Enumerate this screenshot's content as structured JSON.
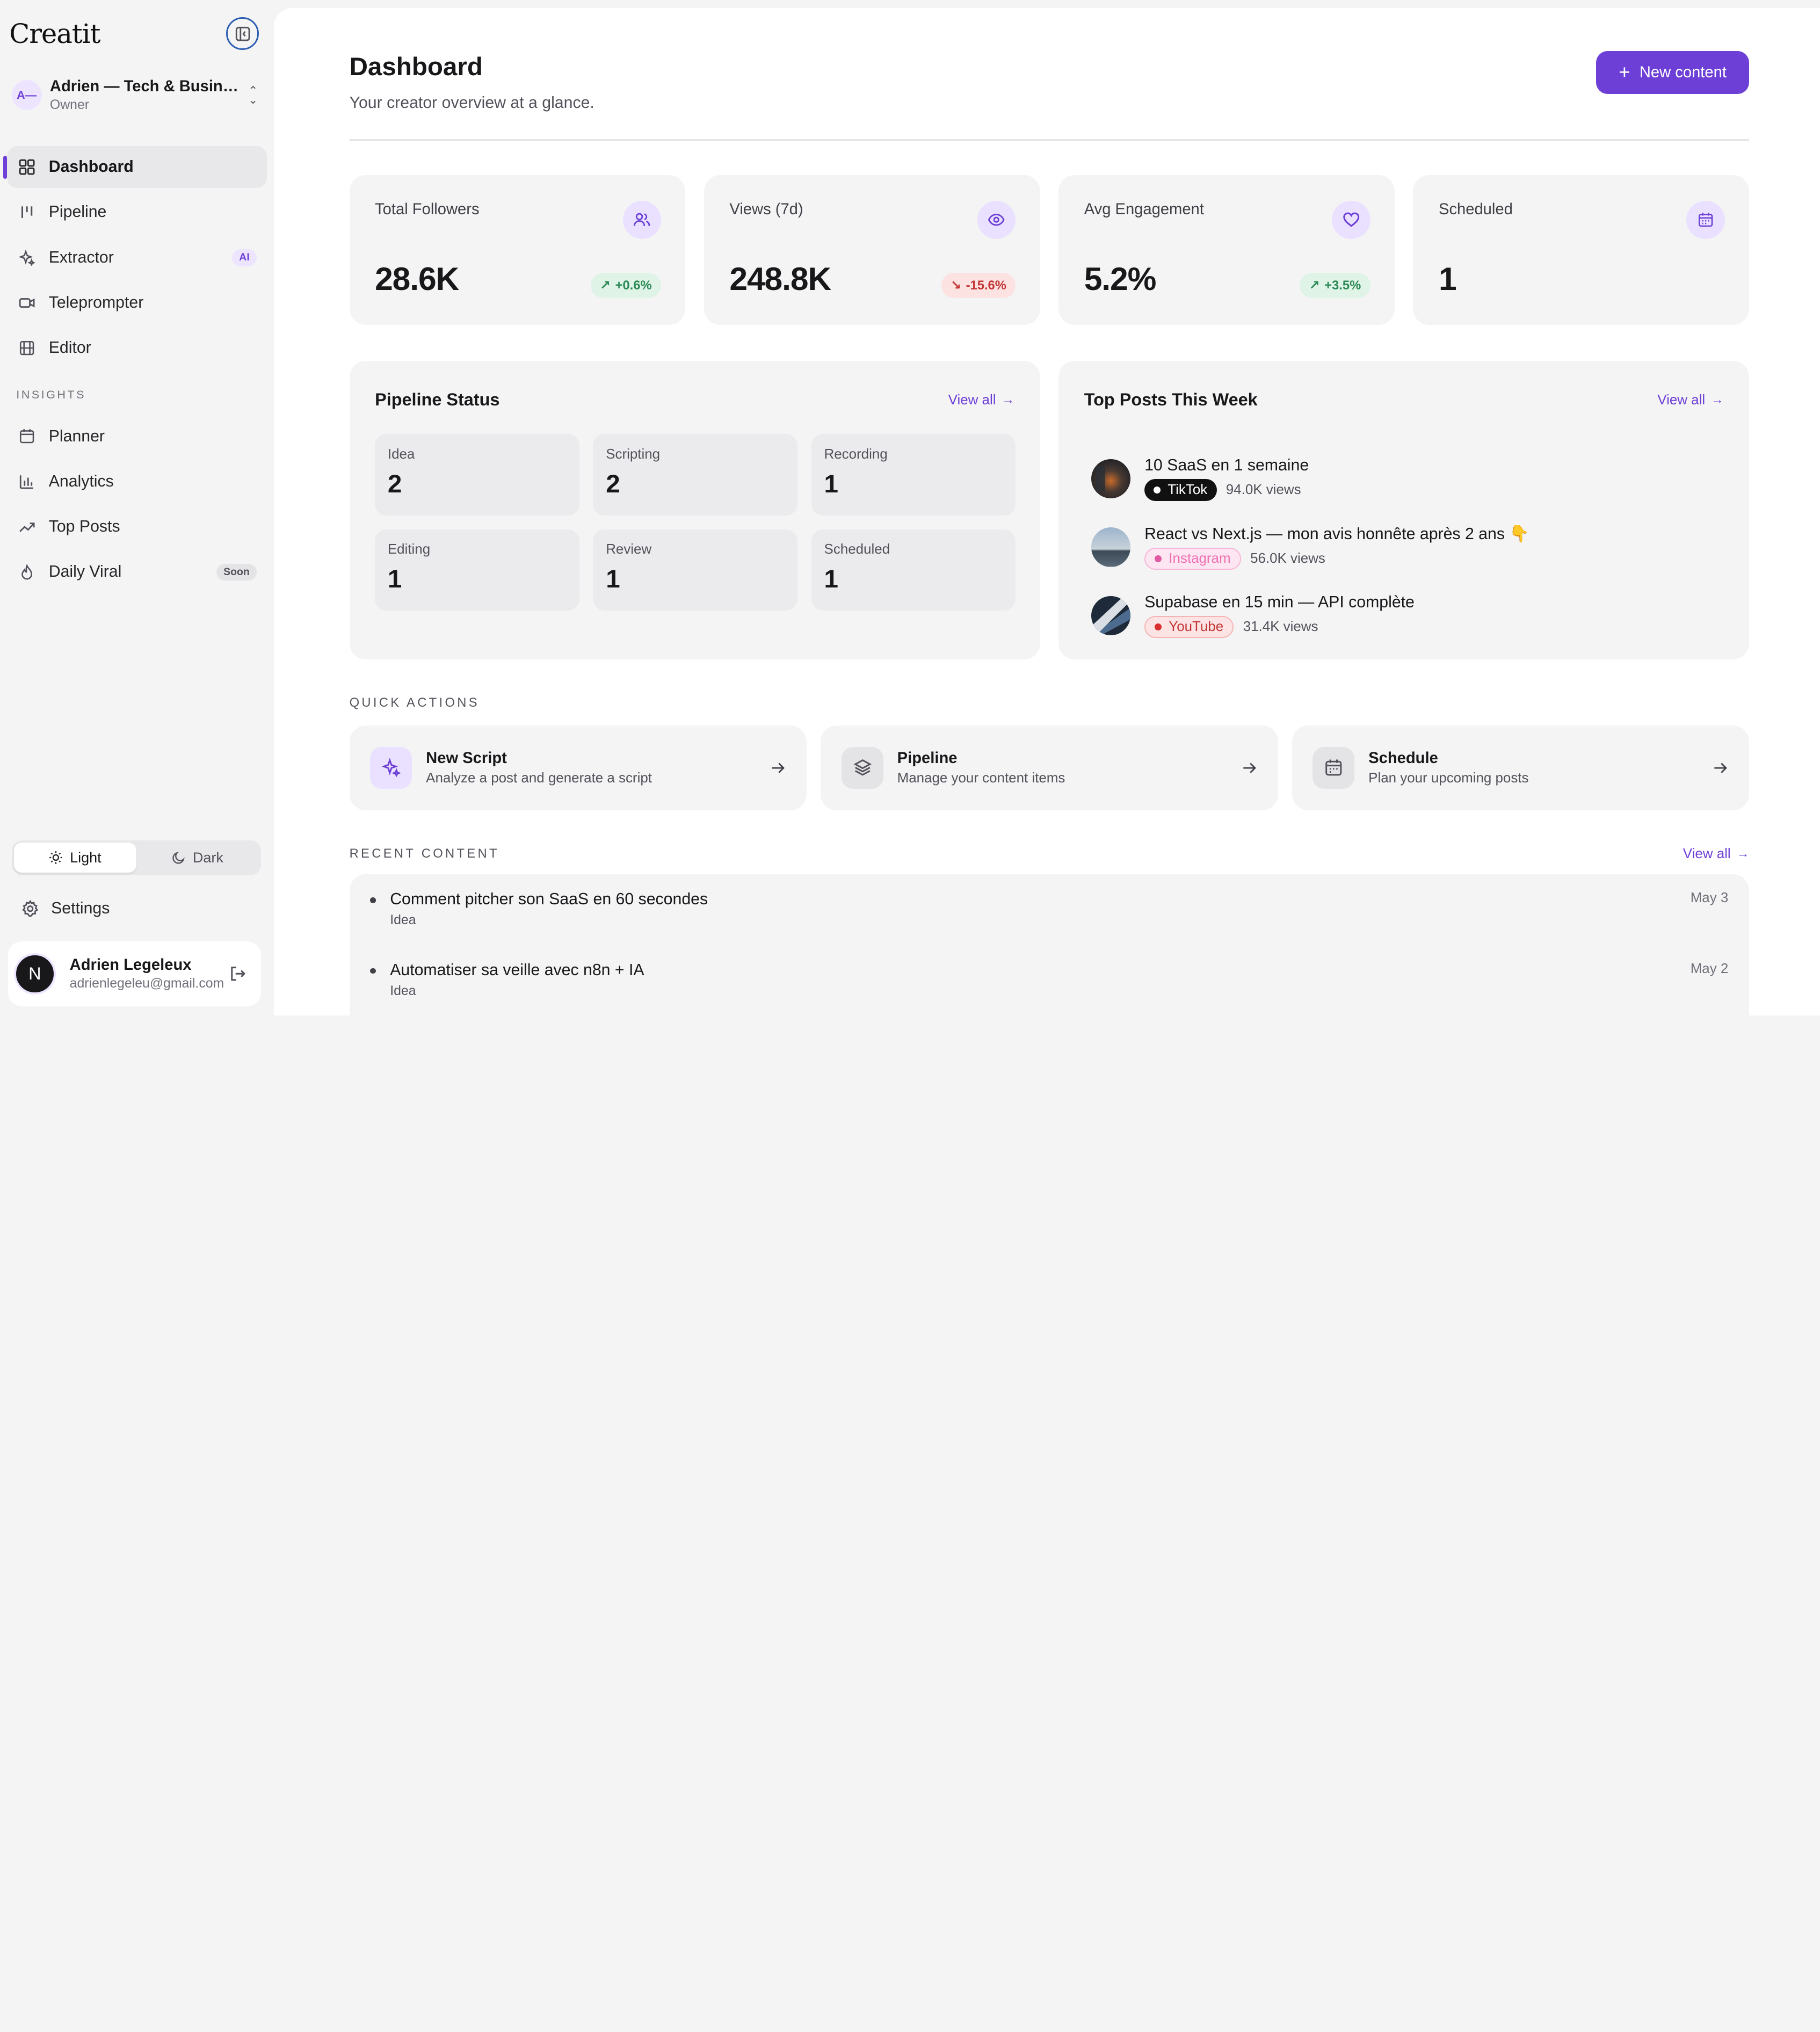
{
  "sidebar": {
    "brand": "Creatit",
    "workspace": {
      "initials": "A—",
      "name": "Adrien — Tech & Business",
      "role": "Owner"
    },
    "nav": [
      {
        "label": "Dashboard",
        "icon": "grid-icon",
        "active": true
      },
      {
        "label": "Pipeline",
        "icon": "kanban-icon"
      },
      {
        "label": "Extractor",
        "icon": "sparkles-icon",
        "badge": "AI"
      },
      {
        "label": "Teleprompter",
        "icon": "video-icon"
      },
      {
        "label": "Editor",
        "icon": "film-icon"
      }
    ],
    "insights_label": "INSIGHTS",
    "insights": [
      {
        "label": "Planner",
        "icon": "calendar-icon"
      },
      {
        "label": "Analytics",
        "icon": "bar-chart-icon"
      },
      {
        "label": "Top Posts",
        "icon": "trending-up-icon"
      },
      {
        "label": "Daily Viral",
        "icon": "flame-icon",
        "badge": "Soon"
      }
    ],
    "theme": {
      "light": "Light",
      "dark": "Dark"
    },
    "settings": "Settings",
    "user": {
      "initial": "N",
      "name": "Adrien Legeleux",
      "email": "adrienlegeleu@gmail.com"
    }
  },
  "header": {
    "title": "Dashboard",
    "subtitle": "Your creator overview at a glance.",
    "new_button": "New content"
  },
  "stats": [
    {
      "label": "Total Followers",
      "value": "28.6K",
      "trend": "+0.6%",
      "direction": "up",
      "icon": "users-icon"
    },
    {
      "label": "Views (7d)",
      "value": "248.8K",
      "trend": "-15.6%",
      "direction": "down",
      "icon": "eye-icon"
    },
    {
      "label": "Avg Engagement",
      "value": "5.2%",
      "trend": "+3.5%",
      "direction": "up",
      "icon": "heart-icon"
    },
    {
      "label": "Scheduled",
      "value": "1",
      "trend": "",
      "direction": "",
      "icon": "calendar-icon"
    }
  ],
  "pipeline": {
    "title": "Pipeline Status",
    "view_all": "View all",
    "stages": [
      {
        "name": "Idea",
        "count": "2"
      },
      {
        "name": "Scripting",
        "count": "2"
      },
      {
        "name": "Recording",
        "count": "1"
      },
      {
        "name": "Editing",
        "count": "1"
      },
      {
        "name": "Review",
        "count": "1"
      },
      {
        "name": "Scheduled",
        "count": "1"
      }
    ]
  },
  "top_posts": {
    "title": "Top Posts This Week",
    "view_all": "View all",
    "items": [
      {
        "title": "10 SaaS en 1 semaine",
        "platform": "TikTok",
        "views": "94.0K views"
      },
      {
        "title": "React vs Next.js — mon avis honnête après 2 ans 👇",
        "platform": "Instagram",
        "views": "56.0K views"
      },
      {
        "title": "Supabase en 15 min — API complète",
        "platform": "YouTube",
        "views": "31.4K views"
      }
    ]
  },
  "quick_actions": {
    "label": "QUICK ACTIONS",
    "items": [
      {
        "title": "New Script",
        "desc": "Analyze a post and generate a script",
        "icon": "sparkles-icon"
      },
      {
        "title": "Pipeline",
        "desc": "Manage your content items",
        "icon": "layers-icon"
      },
      {
        "title": "Schedule",
        "desc": "Plan your upcoming posts",
        "icon": "calendar-icon"
      }
    ]
  },
  "recent": {
    "label": "RECENT CONTENT",
    "view_all": "View all",
    "items": [
      {
        "title": "Comment pitcher son SaaS en 60 secondes",
        "stage": "Idea",
        "date": "May 3"
      },
      {
        "title": "Automatiser sa veille avec n8n + IA",
        "stage": "Idea",
        "date": "May 2"
      }
    ]
  },
  "colors": {
    "accent": "#6d3fd6",
    "up": "#2c8a57",
    "down": "#c43535"
  }
}
